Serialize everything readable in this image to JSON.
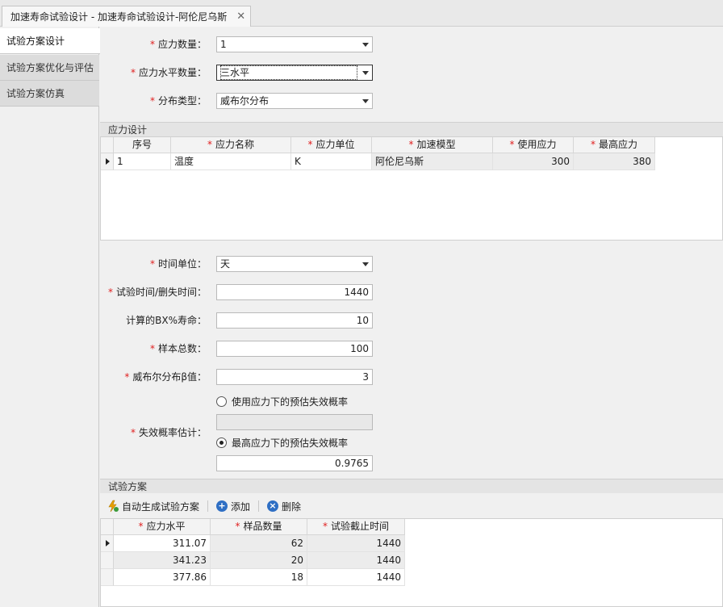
{
  "doc_tab": {
    "title": "加速寿命试验设计 - 加速寿命试验设计-阿伦尼乌斯",
    "close_glyph": "✕"
  },
  "left_tabs": [
    {
      "label": "试验方案设计"
    },
    {
      "label": "试验方案优化与评估"
    },
    {
      "label": "试验方案仿真"
    }
  ],
  "form_top": {
    "stress_count": {
      "label": "应力数量：",
      "value": "1"
    },
    "stress_levels": {
      "label": "应力水平数量：",
      "value": "三水平"
    },
    "distribution": {
      "label": "分布类型：",
      "value": "威布尔分布"
    }
  },
  "stress_design": {
    "title": "应力设计",
    "headers": [
      "序号",
      "应力名称",
      "应力单位",
      "加速模型",
      "使用应力",
      "最高应力"
    ],
    "rows": [
      [
        "1",
        "温度",
        "K",
        "阿伦尼乌斯",
        "300",
        "380"
      ]
    ]
  },
  "form_mid": {
    "time_unit": {
      "label": "时间单位：",
      "value": "天"
    },
    "test_time": {
      "label": "试验时间/删失时间：",
      "value": "1440"
    },
    "bx_life": {
      "label": "计算的BX%寿命：",
      "value": "10"
    },
    "sample_total": {
      "label": "样本总数：",
      "value": "100"
    },
    "weibull_beta": {
      "label": "威布尔分布β值：",
      "value": "3"
    },
    "fail_prob": {
      "label": "失效概率估计：",
      "option_use": "使用应力下的预估失效概率",
      "option_max": "最高应力下的预估失效概率",
      "use_value": "",
      "max_value": "0.9765"
    }
  },
  "test_plan": {
    "title": "试验方案",
    "toolbar": {
      "auto": "自动生成试验方案",
      "add": "添加",
      "delete": "删除"
    },
    "headers": [
      "应力水平",
      "样品数量",
      "试验截止时间"
    ],
    "rows": [
      [
        "311.07",
        "62",
        "1440"
      ],
      [
        "341.23",
        "20",
        "1440"
      ],
      [
        "377.86",
        "18",
        "1440"
      ]
    ]
  },
  "colors": {
    "required": "#e02020",
    "add_icon": "#2f6fc4",
    "delete_icon": "#2f6fc4",
    "bolt_icon": "#e8a100"
  }
}
